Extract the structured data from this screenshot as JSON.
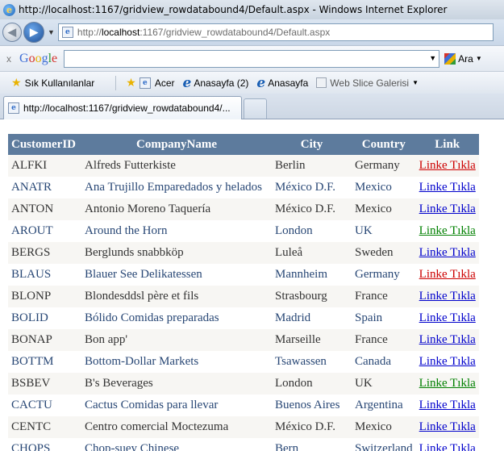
{
  "window": {
    "title": "http://localhost:1167/gridview_rowdatabound4/Default.aspx - Windows Internet Explorer"
  },
  "address": {
    "prefix": "http://",
    "host": "localhost",
    "path": ":1167/gridview_rowdatabound4/Default.aspx"
  },
  "google": {
    "search_value": "",
    "ara_label": "Ara"
  },
  "favorites": {
    "label": "Sık Kullanılanlar",
    "items": [
      {
        "label": "Acer"
      },
      {
        "label": "Anasayfa (2)"
      },
      {
        "label": "Anasayfa"
      },
      {
        "label": "Web Slice Galerisi"
      }
    ]
  },
  "tab": {
    "label": "http://localhost:1167/gridview_rowdatabound4/..."
  },
  "grid": {
    "headers": [
      "CustomerID",
      "CompanyName",
      "City",
      "Country",
      "Link"
    ],
    "link_colors": {
      "red": "#cc0000",
      "blue": "#0000cc",
      "green": "#008000"
    },
    "rows": [
      {
        "id": "ALFKI",
        "company": "Alfreds Futterkiste",
        "city": "Berlin",
        "country": "Germany",
        "link": "Linke Tıkla",
        "link_color": "red"
      },
      {
        "id": "ANATR",
        "company": "Ana Trujillo Emparedados y helados",
        "city": "México D.F.",
        "country": "Mexico",
        "link": "Linke Tıkla",
        "link_color": "blue"
      },
      {
        "id": "ANTON",
        "company": "Antonio Moreno Taquería",
        "city": "México D.F.",
        "country": "Mexico",
        "link": "Linke Tıkla",
        "link_color": "blue"
      },
      {
        "id": "AROUT",
        "company": "Around the Horn",
        "city": "London",
        "country": "UK",
        "link": "Linke Tıkla",
        "link_color": "green"
      },
      {
        "id": "BERGS",
        "company": "Berglunds snabbköp",
        "city": "Luleå",
        "country": "Sweden",
        "link": "Linke Tıkla",
        "link_color": "blue"
      },
      {
        "id": "BLAUS",
        "company": "Blauer See Delikatessen",
        "city": "Mannheim",
        "country": "Germany",
        "link": "Linke Tıkla",
        "link_color": "red"
      },
      {
        "id": "BLONP",
        "company": "Blondesddsl père et fils",
        "city": "Strasbourg",
        "country": "France",
        "link": "Linke Tıkla",
        "link_color": "blue"
      },
      {
        "id": "BOLID",
        "company": "Bólido Comidas preparadas",
        "city": "Madrid",
        "country": "Spain",
        "link": "Linke Tıkla",
        "link_color": "blue"
      },
      {
        "id": "BONAP",
        "company": "Bon app'",
        "city": "Marseille",
        "country": "France",
        "link": "Linke Tıkla",
        "link_color": "blue"
      },
      {
        "id": "BOTTM",
        "company": "Bottom-Dollar Markets",
        "city": "Tsawassen",
        "country": "Canada",
        "link": "Linke Tıkla",
        "link_color": "blue"
      },
      {
        "id": "BSBEV",
        "company": "B's Beverages",
        "city": "London",
        "country": "UK",
        "link": "Linke Tıkla",
        "link_color": "green"
      },
      {
        "id": "CACTU",
        "company": "Cactus Comidas para llevar",
        "city": "Buenos Aires",
        "country": "Argentina",
        "link": "Linke Tıkla",
        "link_color": "blue"
      },
      {
        "id": "CENTC",
        "company": "Centro comercial Moctezuma",
        "city": "México D.F.",
        "country": "Mexico",
        "link": "Linke Tıkla",
        "link_color": "blue"
      },
      {
        "id": "CHOPS",
        "company": "Chop-suey Chinese",
        "city": "Bern",
        "country": "Switzerland",
        "link": "Linke Tıkla",
        "link_color": "blue"
      }
    ]
  }
}
